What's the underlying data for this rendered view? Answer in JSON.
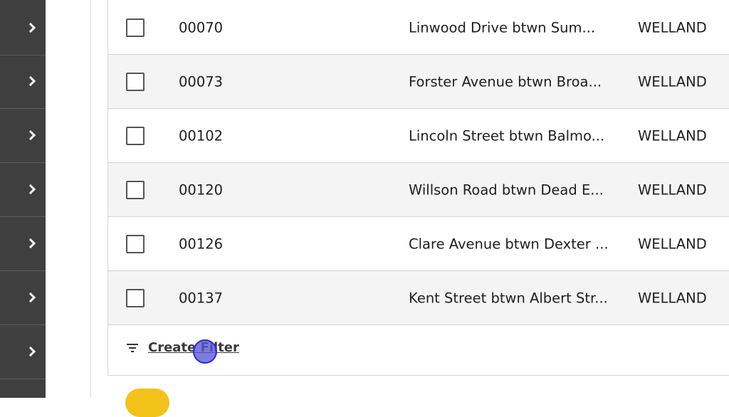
{
  "sidebar": {
    "items": [
      {
        "icon": "chevron-right-icon"
      },
      {
        "icon": "chevron-right-icon"
      },
      {
        "icon": "chevron-right-icon"
      },
      {
        "icon": "chevron-right-icon"
      },
      {
        "icon": "chevron-right-icon"
      },
      {
        "icon": "chevron-right-icon"
      },
      {
        "icon": "chevron-right-icon"
      }
    ]
  },
  "table": {
    "rows": [
      {
        "id": "00070",
        "description": "Linwood Drive btwn Sum...",
        "city": "WELLAND",
        "checked": false
      },
      {
        "id": "00073",
        "description": "Forster Avenue btwn Broa...",
        "city": "WELLAND",
        "checked": false
      },
      {
        "id": "00102",
        "description": "Lincoln Street btwn Balmo...",
        "city": "WELLAND",
        "checked": false
      },
      {
        "id": "00120",
        "description": "Willson Road btwn Dead E...",
        "city": "WELLAND",
        "checked": false
      },
      {
        "id": "00126",
        "description": "Clare Avenue btwn Dexter ...",
        "city": "WELLAND",
        "checked": false
      },
      {
        "id": "00137",
        "description": "Kent Street btwn Albert Str...",
        "city": "WELLAND",
        "checked": false
      }
    ]
  },
  "footer": {
    "create_filter_label": "Create Filter",
    "filter_icon": "filter-lines-icon"
  },
  "colors": {
    "sidebar_bg": "#3f3f3f",
    "row_alt_bg": "#f4f4f4",
    "accent_yellow": "#f2c21b",
    "cursor": "#5856d6"
  }
}
